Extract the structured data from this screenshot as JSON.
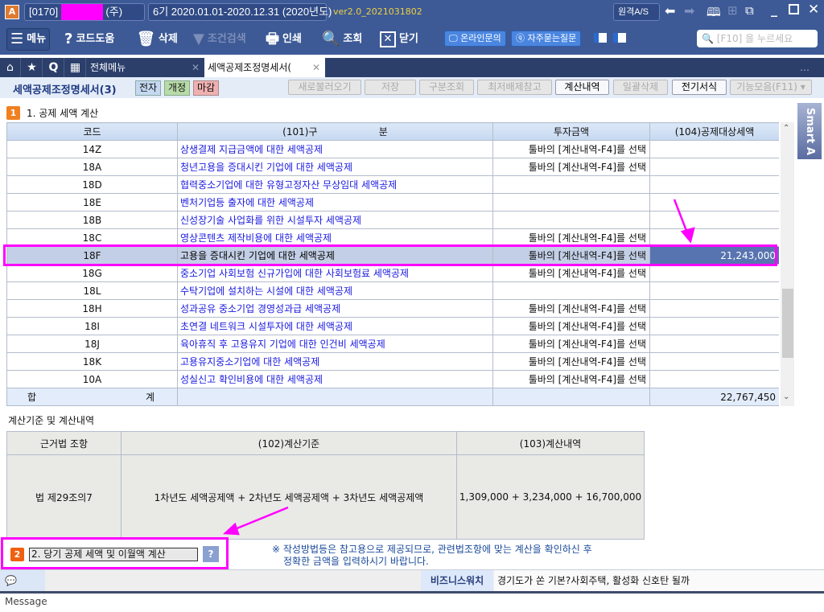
{
  "titlebar": {
    "company_code": "[0170]",
    "company_suffix": "(주)",
    "period": "6기  2020.01.01-2020.12.31  (2020년도)",
    "version": "ver2.0_2021031802",
    "remote_as": "원격A/S"
  },
  "toolbar": {
    "menu": "메뉴",
    "code_help": "코드도움",
    "delete": "삭제",
    "filter": "조건검색",
    "print": "인쇄",
    "search": "조회",
    "close": "닫기",
    "online_inquiry": "온라인문의",
    "faq": "자주묻는질문",
    "search_placeholder": "[F10] 을 누르세요"
  },
  "tabs": {
    "all_menu": "전체메뉴",
    "active": "세액공제조정명세서("
  },
  "subbar": {
    "title": "세액공제조정명세서(3)",
    "badge_e": "전자",
    "badge_revise": "개정",
    "badge_close": "마감",
    "buttons": [
      "새로불러오기",
      "저장",
      "구분조회",
      "최저배제참고",
      "계산내역",
      "일괄삭제",
      "전기서식",
      "기능모음(F11)"
    ],
    "enabled": [
      false,
      false,
      false,
      false,
      true,
      false,
      true,
      false
    ]
  },
  "section1": {
    "number": "1",
    "title": "1. 공제 세액 계산"
  },
  "grid": {
    "headers": [
      "코드",
      "(101)구                    분",
      "투자금액",
      "(104)공제대상세액"
    ],
    "rows": [
      {
        "code": "14Z",
        "name": "상생결제 지급금액에 대한 세액공제",
        "invest": "툴바의 [계산내역-F4]를 선택",
        "amount": ""
      },
      {
        "code": "18A",
        "name": "청년고용을 증대시킨 기업에 대한 세액공제",
        "invest": "툴바의 [계산내역-F4]를 선택",
        "amount": ""
      },
      {
        "code": "18D",
        "name": "협력중소기업에 대한 유형고정자산 무상임대 세액공제",
        "invest": "",
        "amount": ""
      },
      {
        "code": "18E",
        "name": "벤처기업등 출자에 대한 세액공제",
        "invest": "",
        "amount": ""
      },
      {
        "code": "18B",
        "name": "신성장기술 사업화를 위한 시설투자 세액공제",
        "invest": "",
        "amount": ""
      },
      {
        "code": "18C",
        "name": "영상콘텐츠 제작비용에 대한 세액공제",
        "invest": "툴바의 [계산내역-F4]를 선택",
        "amount": ""
      },
      {
        "code": "18F",
        "name": "고용을 증대시킨 기업에 대한 세액공제",
        "invest": "툴바의 [계산내역-F4]를 선택",
        "amount": "21,243,000"
      },
      {
        "code": "18G",
        "name": "중소기업 사회보험 신규가입에 대한 사회보험료 세액공제",
        "invest": "툴바의 [계산내역-F4]를 선택",
        "amount": ""
      },
      {
        "code": "18L",
        "name": "수탁기업에 설치하는 시설에 대한 세액공제",
        "invest": "",
        "amount": ""
      },
      {
        "code": "18H",
        "name": "성과공유 중소기업 경영성과급 세액공제",
        "invest": "툴바의 [계산내역-F4]를 선택",
        "amount": ""
      },
      {
        "code": "18I",
        "name": "초연결 네트워크 시설투자에 대한 세액공제",
        "invest": "툴바의 [계산내역-F4]를 선택",
        "amount": ""
      },
      {
        "code": "18J",
        "name": "육아휴직 후 고용유지 기업에 대한 인건비 세액공제",
        "invest": "툴바의 [계산내역-F4]를 선택",
        "amount": ""
      },
      {
        "code": "18K",
        "name": "고용유지중소기업에 대한 세액공제",
        "invest": "툴바의 [계산내역-F4]를 선택",
        "amount": ""
      },
      {
        "code": "10A",
        "name": "성실신고 확인비용에 대한 세액공제",
        "invest": "툴바의 [계산내역-F4]를 선택",
        "amount": ""
      }
    ],
    "total_label_1": "합",
    "total_label_2": "계",
    "total_amount": "22,767,450"
  },
  "calc": {
    "title": "계산기준 및 계산내역",
    "headers": [
      "근거법 조항",
      "(102)계산기준",
      "(103)계산내역"
    ],
    "law": "법 제29조의7",
    "basis": "1차년도 세액공제액 + 2차년도 세액공제액 + 3차년도 세액공제액",
    "detail": "1,309,000 + 3,234,000 + 16,700,000"
  },
  "section2": {
    "number": "2",
    "title": "2. 당기 공제 세액 및 이월액 계산",
    "help": "?"
  },
  "notice": {
    "line1": "※ 작성방법등은 참고용으로 제공되므로, 관련법조항에 맞는 계산을 확인하신 후",
    "line2": "정확한 금액을 입력하시기 바랍니다."
  },
  "statusbar": {
    "message": "Message",
    "biz_label": "비즈니스워치",
    "news": "경기도가 쏜 기본?사회주택, 활성화 신호탄 될까"
  },
  "smart": {
    "label": "Smart A"
  },
  "colors": {
    "highlight": "#ff00ff",
    "selected_cell": "#5874b0",
    "link_text": "#1a1ae0"
  }
}
